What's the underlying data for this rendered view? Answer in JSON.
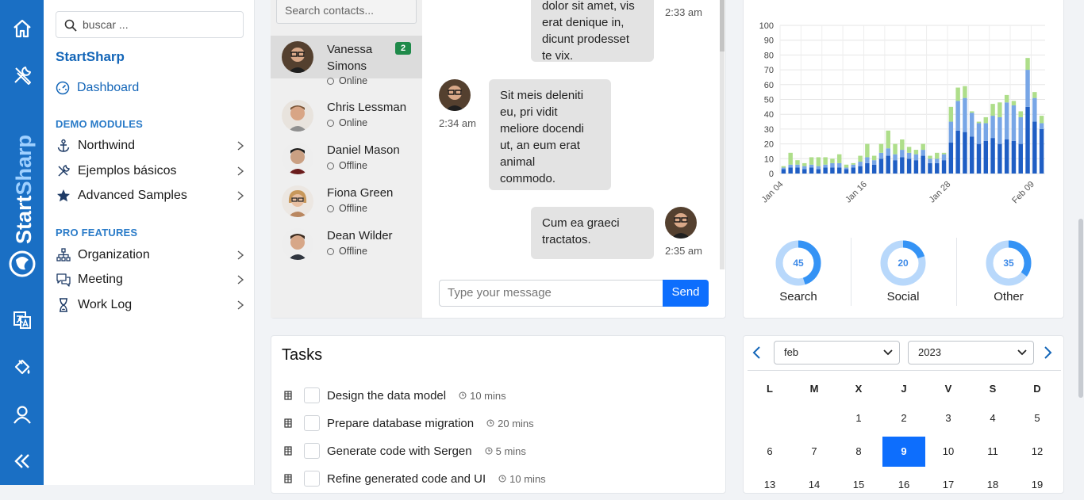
{
  "rail": {
    "brand": "StartSharp",
    "icons": [
      "home-icon",
      "tools-icon",
      "translate-icon",
      "paint-bucket-icon",
      "user-icon",
      "collapse-icon"
    ]
  },
  "sidebar": {
    "search_placeholder": "buscar ...",
    "brand": "StartSharp",
    "dashboard": "Dashboard",
    "demo_modules": "DEMO MODULES",
    "demo_items": [
      {
        "label": "Northwind",
        "icon": "anchor-icon"
      },
      {
        "label": "Ejemplos básicos",
        "icon": "tools-icon"
      },
      {
        "label": "Advanced Samples",
        "icon": "star-icon"
      }
    ],
    "pro_features": "PRO FEATURES",
    "pro_items": [
      {
        "label": "Organization",
        "icon": "org-chart-icon"
      },
      {
        "label": "Meeting",
        "icon": "chat-icon"
      },
      {
        "label": "Work Log",
        "icon": "hourglass-icon"
      }
    ]
  },
  "chat": {
    "search_placeholder": "Search contacts...",
    "contacts": [
      {
        "first": "Vanessa",
        "last": "Simons",
        "status": "Online",
        "unread": "2"
      },
      {
        "name": "Chris Lessman",
        "status": "Online"
      },
      {
        "name": "Daniel Mason",
        "status": "Offline"
      },
      {
        "name": "Fiona Green",
        "status": "Offline"
      },
      {
        "name": "Dean Wilder",
        "status": "Offline"
      }
    ],
    "messages": [
      {
        "lines": [
          "dolor sit amet, vis",
          "erat denique in,",
          "dicunt prodesset",
          "te vix."
        ],
        "time": "2:33 am"
      },
      {
        "lines": [
          "Sit meis deleniti",
          "eu, pri vidit",
          "meliore docendi",
          "ut, an eum erat",
          "animal",
          "commodo."
        ],
        "time": "2:34 am"
      },
      {
        "lines": [
          "Cum ea graeci",
          "tractatos."
        ],
        "time": "2:35 am"
      }
    ],
    "input_placeholder": "Type your message",
    "send": "Send"
  },
  "chart_data": {
    "type": "bar",
    "stacked": true,
    "x_ticks": [
      "Jan 04",
      "Jan 16",
      "Jan 28",
      "Feb 09"
    ],
    "ylim": [
      0,
      100
    ],
    "y_ticks": [
      0,
      10,
      20,
      30,
      40,
      50,
      60,
      70,
      80,
      90,
      100
    ],
    "grid": true,
    "colors": [
      "#1f5ec4",
      "#78a6e6",
      "#aede8a"
    ],
    "series": [
      {
        "values": [
          3,
          4,
          4,
          3,
          4,
          3,
          4,
          4,
          4,
          3,
          4,
          5,
          7,
          6,
          10,
          12,
          9,
          11,
          10,
          9,
          12,
          7,
          7,
          9,
          21,
          29,
          28,
          25,
          20,
          22,
          24,
          20,
          23,
          22,
          20,
          45,
          35,
          30
        ]
      },
      {
        "values": [
          1,
          2,
          2,
          2,
          2,
          2,
          2,
          3,
          3,
          1,
          2,
          3,
          4,
          3,
          4,
          5,
          4,
          5,
          4,
          4,
          4,
          3,
          3,
          4,
          14,
          20,
          23,
          16,
          14,
          12,
          15,
          18,
          25,
          24,
          18,
          25,
          16,
          4
        ]
      },
      {
        "values": [
          1,
          8,
          3,
          2,
          5,
          6,
          5,
          3,
          6,
          2,
          1,
          4,
          9,
          3,
          6,
          12,
          7,
          7,
          4,
          3,
          4,
          2,
          4,
          1,
          10,
          9,
          8,
          1,
          1,
          4,
          8,
          10,
          5,
          3,
          4,
          8,
          4,
          5
        ]
      }
    ]
  },
  "donuts": [
    {
      "value": "45",
      "label": "Search",
      "fraction": 0.45
    },
    {
      "value": "20",
      "label": "Social",
      "fraction": 0.2
    },
    {
      "value": "35",
      "label": "Other",
      "fraction": 0.35
    }
  ],
  "tasks": {
    "title": "Tasks",
    "items": [
      {
        "label": "Design the data model",
        "duration": "10 mins"
      },
      {
        "label": "Prepare database migration",
        "duration": "20 mins"
      },
      {
        "label": "Generate code with Sergen",
        "duration": "5 mins"
      },
      {
        "label": "Refine generated code and UI",
        "duration": "10 mins"
      }
    ]
  },
  "calendar": {
    "month": "feb",
    "year": "2023",
    "weekdays": [
      "L",
      "M",
      "X",
      "J",
      "V",
      "S",
      "D"
    ],
    "rows": [
      [
        "",
        "",
        "1",
        "2",
        "3",
        "4",
        "5"
      ],
      [
        "6",
        "7",
        "8",
        "9",
        "10",
        "11",
        "12"
      ],
      [
        "13",
        "14",
        "15",
        "16",
        "17",
        "18",
        "19"
      ]
    ],
    "today": "9"
  }
}
